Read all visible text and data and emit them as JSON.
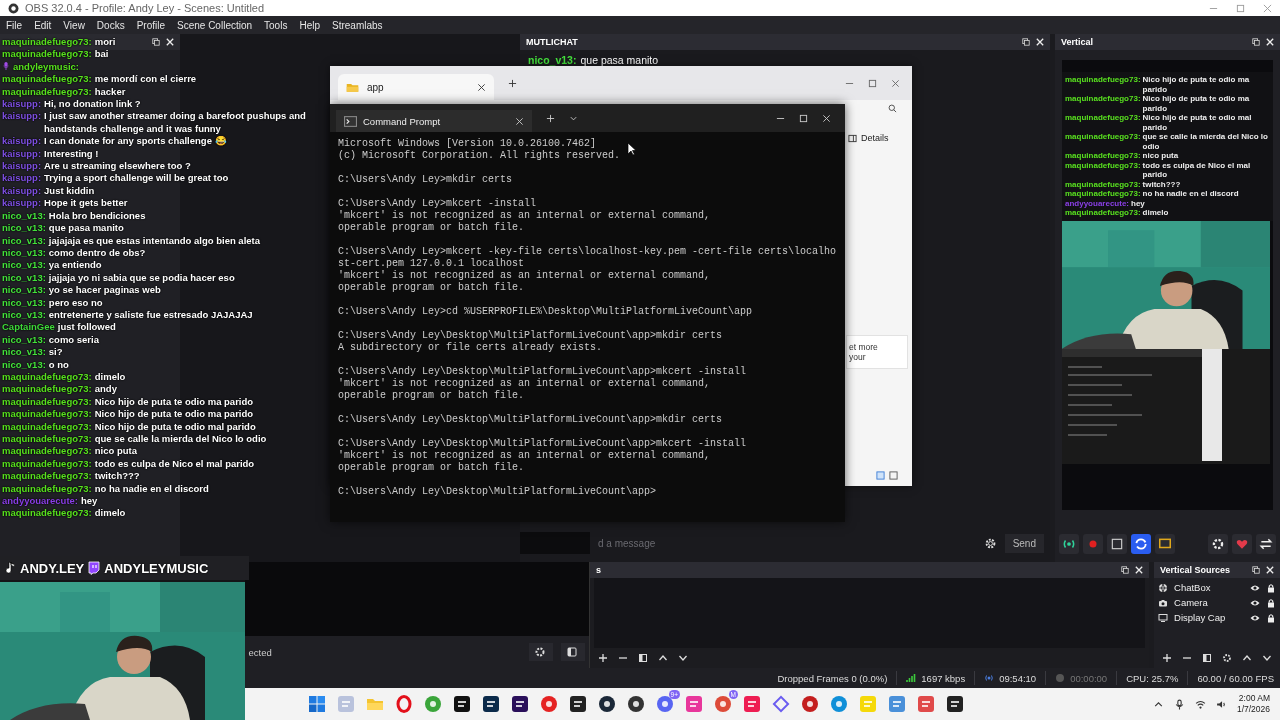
{
  "window": {
    "title": "OBS 32.0.4 - Profile: Andy Ley - Scenes: Untitled"
  },
  "menu": [
    "File",
    "Edit",
    "View",
    "Docks",
    "Profile",
    "Scene Collection",
    "Tools",
    "Help",
    "Streamlabs"
  ],
  "chat_overlay": {
    "messages": [
      {
        "kind": "message",
        "user": "maquinadefuego73:",
        "text": "mori",
        "color": "#58e01f"
      },
      {
        "kind": "message",
        "user": "maquinadefuego73:",
        "text": "bai",
        "color": "#58e01f"
      },
      {
        "kind": "broadcaster",
        "user": "andyleymusic:",
        "color": "#58e01f"
      },
      {
        "kind": "message",
        "user": "maquinadefuego73:",
        "text": "me mordí con el cierre",
        "color": "#58e01f"
      },
      {
        "kind": "message",
        "user": "maquinadefuego73:",
        "text": "hacker",
        "color": "#58e01f"
      },
      {
        "kind": "message",
        "user": "kaisupp:",
        "text": "Hi, no donation link ?",
        "color": "#7d4fe0"
      },
      {
        "kind": "message",
        "user": "kaisupp:",
        "text": "I just saw another streamer doing a barefoot pushups and handstands challenge and it was funny",
        "color": "#7d4fe0"
      },
      {
        "kind": "message",
        "user": "kaisupp:",
        "text": "I can donate for any sports challenge 😂",
        "color": "#7d4fe0"
      },
      {
        "kind": "message",
        "user": "kaisupp:",
        "text": "Interesting !",
        "color": "#7d4fe0"
      },
      {
        "kind": "message",
        "user": "kaisupp:",
        "text": "Are u streaming elsewhere too ?",
        "color": "#7d4fe0"
      },
      {
        "kind": "message",
        "user": "kaisupp:",
        "text": "Trying a sport challenge will be great too",
        "color": "#7d4fe0"
      },
      {
        "kind": "message",
        "user": "kaisupp:",
        "text": "Just kiddin",
        "color": "#7d4fe0"
      },
      {
        "kind": "message",
        "user": "kaisupp:",
        "text": "Hope it gets better",
        "color": "#7d4fe0"
      },
      {
        "kind": "message",
        "user": "nico_v13:",
        "text": "Hola bro bendiciones",
        "color": "#44e23c"
      },
      {
        "kind": "message",
        "user": "nico_v13:",
        "text": "que pasa manito",
        "color": "#44e23c"
      },
      {
        "kind": "message",
        "user": "nico_v13:",
        "text": "jajajaja es que estas intentando algo bien aleta",
        "color": "#44e23c"
      },
      {
        "kind": "message",
        "user": "nico_v13:",
        "text": "como dentro de obs?",
        "color": "#44e23c"
      },
      {
        "kind": "message",
        "user": "nico_v13:",
        "text": "ya entiendo",
        "color": "#44e23c"
      },
      {
        "kind": "message",
        "user": "nico_v13:",
        "text": "jajjaja yo ni sabia que se podia hacer eso",
        "color": "#44e23c"
      },
      {
        "kind": "message",
        "user": "nico_v13:",
        "text": "yo se hacer paginas web",
        "color": "#44e23c"
      },
      {
        "kind": "message",
        "user": "nico_v13:",
        "text": "pero eso no",
        "color": "#44e23c"
      },
      {
        "kind": "message",
        "user": "nico_v13:",
        "text": "entretenerte y saliste fue estresado JAJAJAJ",
        "color": "#44e23c"
      },
      {
        "kind": "follow",
        "user": "CaptainGee",
        "text": "just followed",
        "color": "#3fd93a"
      },
      {
        "kind": "message",
        "user": "nico_v13:",
        "text": "como seria",
        "color": "#44e23c"
      },
      {
        "kind": "message",
        "user": "nico_v13:",
        "text": "si?",
        "color": "#44e23c"
      },
      {
        "kind": "message",
        "user": "nico_v13:",
        "text": "o no",
        "color": "#44e23c"
      },
      {
        "kind": "message",
        "user": "maquinadefuego73:",
        "text": "dimelo",
        "color": "#58e01f"
      },
      {
        "kind": "message",
        "user": "maquinadefuego73:",
        "text": "andy",
        "color": "#58e01f"
      },
      {
        "kind": "message",
        "user": "maquinadefuego73:",
        "text": "Nico hijo de puta te odio ma parido",
        "color": "#58e01f"
      },
      {
        "kind": "message",
        "user": "maquinadefuego73:",
        "text": "Nico hijo de puta te odio ma parido",
        "color": "#58e01f"
      },
      {
        "kind": "message",
        "user": "maquinadefuego73:",
        "text": "Nico hijo de puta te odio mal parido",
        "color": "#58e01f"
      },
      {
        "kind": "message",
        "user": "maquinadefuego73:",
        "text": "que se calle la mierda del Nico lo odio",
        "color": "#58e01f"
      },
      {
        "kind": "message",
        "user": "maquinadefuego73:",
        "text": "nico puta",
        "color": "#58e01f"
      },
      {
        "kind": "message",
        "user": "maquinadefuego73:",
        "text": "todo es culpa de Nico el mal parido",
        "color": "#58e01f"
      },
      {
        "kind": "message",
        "user": "maquinadefuego73:",
        "text": "twitch???",
        "color": "#58e01f"
      },
      {
        "kind": "message",
        "user": "maquinadefuego73:",
        "text": "no ha nadie en el discord",
        "color": "#58e01f"
      },
      {
        "kind": "message",
        "user": "andyyouarecute:",
        "text": "hey",
        "color": "#8a3fe6"
      },
      {
        "kind": "message",
        "user": "maquinadefuego73:",
        "text": "dimelo",
        "color": "#58e01f"
      }
    ],
    "banner": [
      "ANDY.LEY",
      "ANDYLEYMUSIC"
    ]
  },
  "explorer": {
    "tab": "app",
    "details_button": "Details",
    "card_text": [
      "et more",
      "your"
    ]
  },
  "terminal": {
    "tab": "Command Prompt",
    "blocks": [
      [
        "Microsoft Windows [Version 10.0.26100.7462]",
        "(c) Microsoft Corporation. All rights reserved."
      ],
      [
        "C:\\Users\\Andy Ley>mkdir certs"
      ],
      [
        "C:\\Users\\Andy Ley>mkcert -install",
        "'mkcert' is not recognized as an internal or external command,",
        "operable program or batch file."
      ],
      [
        "C:\\Users\\Andy Ley>mkcert -key-file certs\\localhost-key.pem -cert-file certs\\localhost-cert.pem 127.0.0.1 localhost",
        "'mkcert' is not recognized as an internal or external command,",
        "operable program or batch file."
      ],
      [
        "C:\\Users\\Andy Ley>cd %USERPROFILE%\\Desktop\\MultiPlatformLiveCount\\app"
      ],
      [
        "C:\\Users\\Andy Ley\\Desktop\\MultiPlatformLiveCount\\app>mkdir certs",
        "A subdirectory or file certs already exists."
      ],
      [
        "C:\\Users\\Andy Ley\\Desktop\\MultiPlatformLiveCount\\app>mkcert -install",
        "'mkcert' is not recognized as an internal or external command,",
        "operable program or batch file."
      ],
      [
        "C:\\Users\\Andy Ley\\Desktop\\MultiPlatformLiveCount\\app>mkdir certs"
      ],
      [
        "C:\\Users\\Andy Ley\\Desktop\\MultiPlatformLiveCount\\app>mkcert -install",
        "'mkcert' is not recognized as an internal or external command,",
        "operable program or batch file."
      ],
      [
        "C:\\Users\\Andy Ley\\Desktop\\MultiPlatformLiveCount\\app>"
      ]
    ]
  },
  "multichat": {
    "title": "MUTLICHAT",
    "messages": [
      {
        "user": "nico_v13:",
        "text": "que pasa manito",
        "color": "#44e23c"
      }
    ],
    "placeholder": "d a message",
    "send": "Send"
  },
  "vertical": {
    "title": "Vertical",
    "preview_chat": [
      {
        "user": "maquinadefuego73:",
        "text": "Nico hijo de puta te odio ma parido",
        "color": "#58e01f"
      },
      {
        "user": "maquinadefuego73:",
        "text": "Nico hijo de puta te odio ma parido",
        "color": "#58e01f"
      },
      {
        "user": "maquinadefuego73:",
        "text": "Nico hijo de puta te odio mal parido",
        "color": "#58e01f"
      },
      {
        "user": "maquinadefuego73:",
        "text": "que se calle la mierda del Nico lo odio",
        "color": "#58e01f"
      },
      {
        "user": "maquinadefuego73:",
        "text": "nico puta",
        "color": "#58e01f"
      },
      {
        "user": "maquinadefuego73:",
        "text": "todo es culpa de Nico el mal parido",
        "color": "#58e01f"
      },
      {
        "user": "maquinadefuego73:",
        "text": "twitch???",
        "color": "#58e01f"
      },
      {
        "user": "maquinadefuego73:",
        "text": "no ha nadie en el discord",
        "color": "#58e01f"
      },
      {
        "user": "andyyouarecute:",
        "text": "hey",
        "color": "#8a3fe6"
      },
      {
        "user": "maquinadefuego73:",
        "text": "dimelo",
        "color": "#58e01f"
      }
    ]
  },
  "sources_dock": {
    "status": "ected"
  },
  "mid_dock": {
    "title": "s"
  },
  "vertical_sources": {
    "title": "Vertical Sources",
    "items": [
      {
        "name": "ChatBox",
        "kind": "browser"
      },
      {
        "name": "Camera",
        "kind": "camera"
      },
      {
        "name": "Display Cap",
        "kind": "display"
      }
    ]
  },
  "status_bar": {
    "dropped_frames": "Dropped Frames 0 (0.0%)",
    "bitrate": "1697 kbps",
    "stream_time": "09:54:10",
    "record_time": "00:00:00",
    "cpu": "CPU: 25.7%",
    "fps": "60.00 / 60.00 FPS"
  },
  "taskbar": {
    "badges": [
      "9+",
      "M"
    ],
    "time": "2:00 AM",
    "date": "1/7/2026"
  }
}
